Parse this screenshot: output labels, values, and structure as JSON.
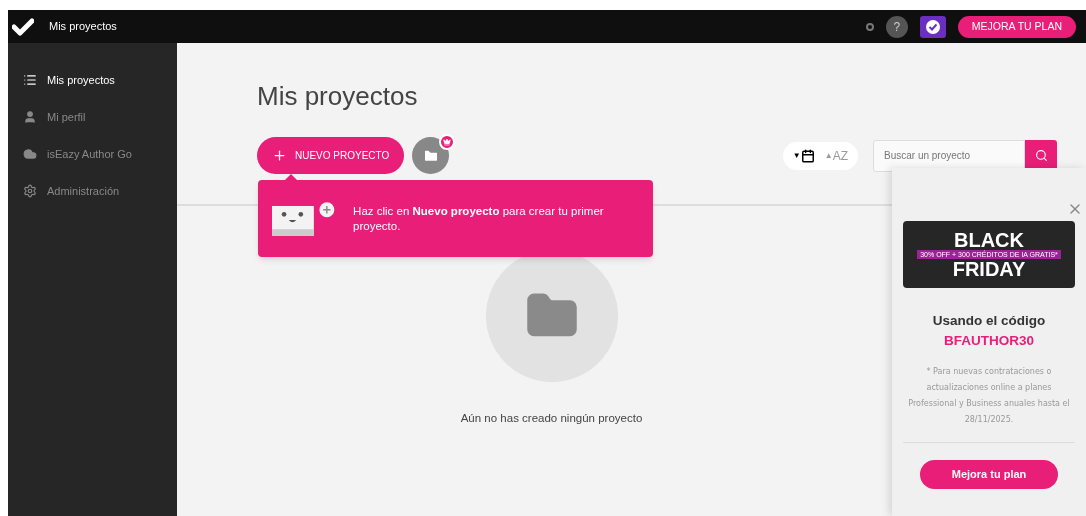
{
  "topbar": {
    "title": "Mis proyectos",
    "help": "?",
    "upgrade": "MEJORA TU PLAN"
  },
  "sidebar": {
    "items": [
      {
        "label": "Mis proyectos",
        "kind": "list",
        "selected": true
      },
      {
        "label": "Mi perfil",
        "kind": "user",
        "selected": false
      },
      {
        "label": "isEazy Author Go",
        "kind": "cloud",
        "selected": false
      },
      {
        "label": "Administración",
        "kind": "gear",
        "selected": false
      }
    ]
  },
  "main": {
    "title": "Mis proyectos",
    "new_button": "NUEVO PROYECTO",
    "sort": [
      {
        "kind": "date",
        "arrow": "▼",
        "selected": true
      },
      {
        "kind": "alpha",
        "arrow": "▲",
        "label": "AZ",
        "selected": false
      }
    ],
    "search": {
      "placeholder": "Buscar un proyecto"
    },
    "tip": "Haz clic en **Nuevo proyecto** para crear tu primer proyecto.",
    "empty": "Aún no has creado ningún proyecto"
  },
  "promo": {
    "banner": {
      "top": "BLACK",
      "ribbon": "30% OFF + 300 CRÉDITOS DE IA GRATIS*",
      "bottom": "FRIDAY"
    },
    "heading": "Usando el código",
    "code": "BFAUTHOR30",
    "note": "* Para nuevas contrataciones o actualizaciones online a planes Professional y Business anuales hasta el 28/11/2025.",
    "button": "Mejora tu plan"
  }
}
